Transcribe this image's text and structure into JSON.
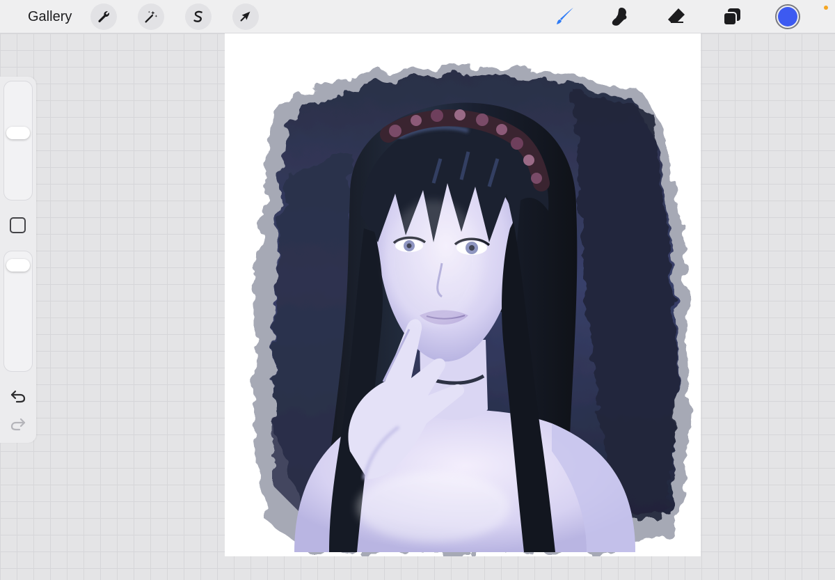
{
  "toolbar": {
    "gallery_label": "Gallery",
    "left_tools": [
      {
        "name": "actions",
        "icon": "wrench-icon"
      },
      {
        "name": "adjustments",
        "icon": "magic-wand-icon"
      },
      {
        "name": "selection",
        "icon": "selection-s-icon"
      },
      {
        "name": "transform",
        "icon": "arrow-cursor-icon"
      }
    ],
    "right_tools": [
      {
        "name": "brush",
        "icon": "brush-icon",
        "active": true
      },
      {
        "name": "smudge",
        "icon": "smudge-finger-icon"
      },
      {
        "name": "eraser",
        "icon": "eraser-icon"
      },
      {
        "name": "layers",
        "icon": "layers-icon"
      }
    ]
  },
  "colors": {
    "active_tool": "#2f7cf6",
    "current_color": "#3d5af1",
    "status_dot": "#f5a623"
  },
  "sidebar": {
    "brush_size": 0.59,
    "brush_opacity": 0.98,
    "undo_icon": "undo-icon",
    "redo_icon": "redo-icon"
  }
}
